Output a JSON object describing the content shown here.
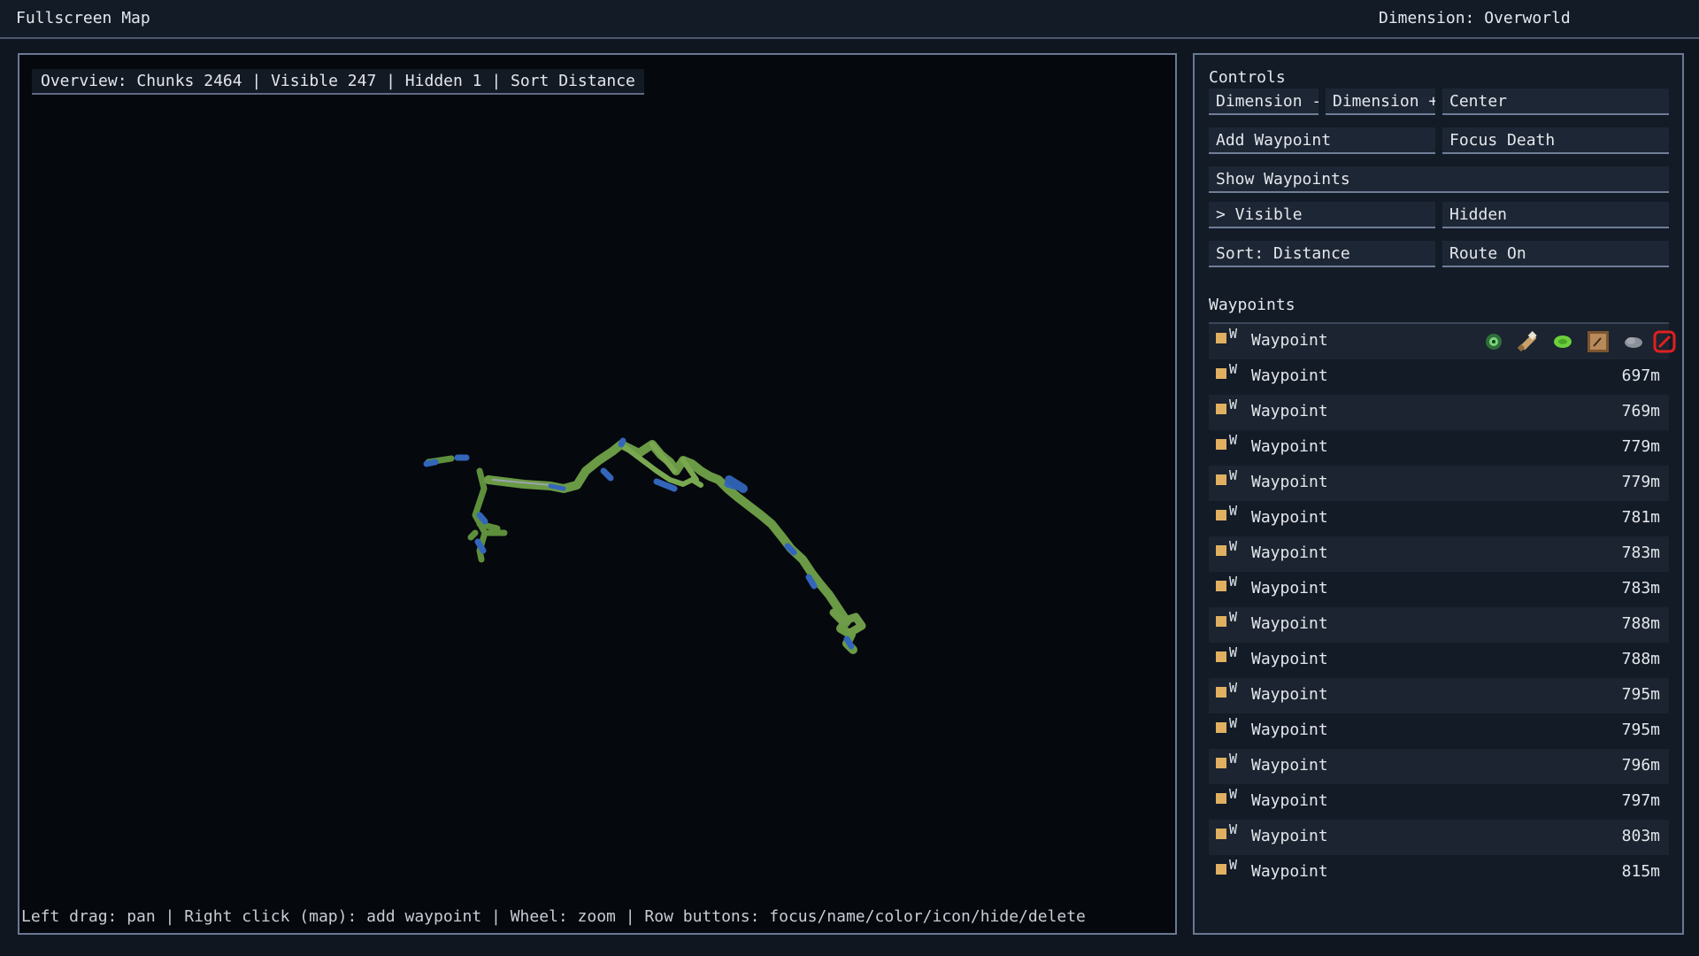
{
  "header": {
    "title": "Fullscreen Map",
    "dimension": "Dimension: Overworld"
  },
  "map": {
    "overview": "Overview: Chunks 2464 | Visible 247 | Hidden 1 | Sort Distance",
    "hint": "Left drag: pan | Right click (map): add waypoint | Wheel: zoom | Row buttons: focus/name/color/icon/hide/delete"
  },
  "controls": {
    "title": "Controls",
    "dimension_minus": "Dimension -",
    "dimension_plus": "Dimension +",
    "center": "Center",
    "add_waypoint": "Add Waypoint",
    "focus_death": "Focus Death",
    "show_waypoints": "Show Waypoints",
    "visible": "> Visible",
    "hidden": "Hidden",
    "sort": "Sort: Distance",
    "route": "Route On"
  },
  "waypoints": {
    "title": "Waypoints",
    "marker": "W",
    "items": [
      {
        "name": "Waypoint",
        "distance": ""
      },
      {
        "name": "Waypoint",
        "distance": "697m"
      },
      {
        "name": "Waypoint",
        "distance": "769m"
      },
      {
        "name": "Waypoint",
        "distance": "779m"
      },
      {
        "name": "Waypoint",
        "distance": "779m"
      },
      {
        "name": "Waypoint",
        "distance": "781m"
      },
      {
        "name": "Waypoint",
        "distance": "783m"
      },
      {
        "name": "Waypoint",
        "distance": "783m"
      },
      {
        "name": "Waypoint",
        "distance": "788m"
      },
      {
        "name": "Waypoint",
        "distance": "788m"
      },
      {
        "name": "Waypoint",
        "distance": "795m"
      },
      {
        "name": "Waypoint",
        "distance": "795m"
      },
      {
        "name": "Waypoint",
        "distance": "796m"
      },
      {
        "name": "Waypoint",
        "distance": "797m"
      },
      {
        "name": "Waypoint",
        "distance": "803m"
      },
      {
        "name": "Waypoint",
        "distance": "815m"
      }
    ],
    "row_tools": [
      "eye-icon",
      "spyglass-icon",
      "slime-icon",
      "map-frame-icon",
      "cloud-icon",
      "delete-icon"
    ]
  },
  "colors": {
    "terrain_green": "#6a9a45",
    "water_blue": "#3366bb",
    "waypoint_marker": "#e0b060",
    "delete_red": "#e02020"
  }
}
